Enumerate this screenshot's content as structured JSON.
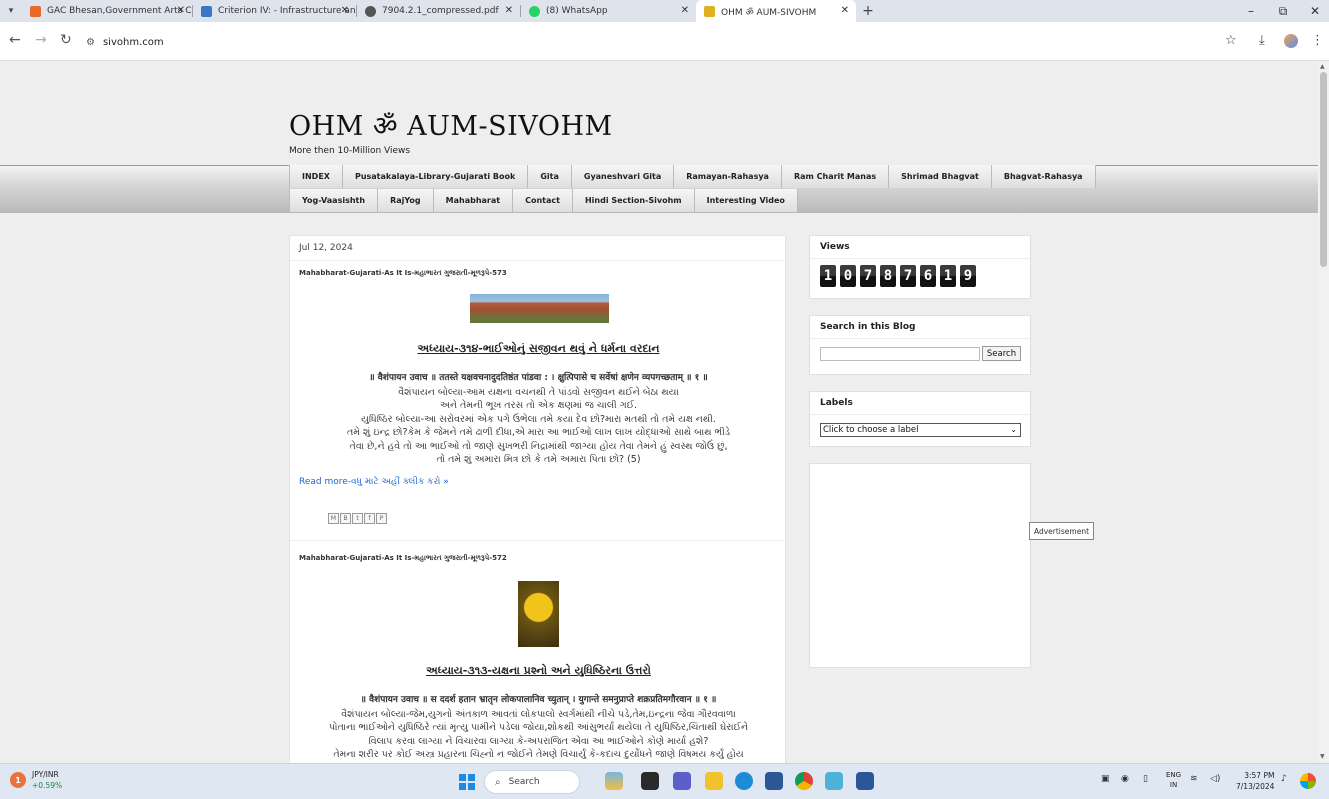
{
  "browser": {
    "tabs": [
      {
        "label": "GAC Bhesan,Government Arts C",
        "icon": "college-favicon-icon",
        "color": "#e66b2a"
      },
      {
        "label": "Criterion IV: - Infrastructure and",
        "icon": "site-favicon-icon",
        "color": "#3b78c4"
      },
      {
        "label": "7904.2.1_compressed.pdf",
        "icon": "globe-favicon-icon",
        "color": "#555555"
      },
      {
        "label": "(8) WhatsApp",
        "icon": "whatsapp-favicon-icon",
        "color": "#25d366"
      },
      {
        "label": "OHM ॐ AUM-SIVOHM",
        "icon": "om-favicon-icon",
        "color": "#e0b020"
      }
    ],
    "url": "sivohm.com"
  },
  "blog": {
    "title": "OHM ॐ AUM-SIVOHM",
    "description": "More then 10-Million Views",
    "nav_row1": [
      "INDEX",
      "Pusatakalaya-Library-Gujarati Book",
      "Gita",
      "Gyaneshvari Gita",
      "Ramayan-Rahasya",
      "Ram Charit Manas",
      "Shrimad Bhagvat",
      "Bhagvat-Rahasya"
    ],
    "nav_row2": [
      "Yog-Vaasishth",
      "RajYog",
      "Mahabharat",
      "Contact",
      "Hindi Section-Sivohm",
      "Interesting Video"
    ]
  },
  "posts": {
    "date": "Jul 12, 2024",
    "post1": {
      "title": "Mahabharat-Gujarati-As It Is-મહાભારત ગુજરાતી-મૂળરૂપે-573",
      "chapter": "અધ્યાય-૩૧૪-ભાઈઓનું સજીવન થવું ને ધર્મના વરદાન",
      "sanskrit": "॥ वैशंपायन उवाच ॥ ततस्ते यक्षवचनादुदतिष्ठंत पांडवा : । क्षुत्पिपासे च सर्वेषां क्षणेन व्यपगच्छताम् ॥ १ ॥",
      "lines": [
        "વૈશંપાયન બોલ્યા-આમ યક્ષના વચનથી તે પાંડવો સજીવન થઈને બેઠા થયા",
        "અને તેમની ભૂખ તરસ તો એક ક્ષણમાં જ ચાલી ગઈ.",
        "યુધિષ્ઠિર બોલ્યા-આ સરોવરમાં એક પગે ઉભેલા તમે કયા દેવ છો?મારા મતથી તો તમે યક્ષ નથી.",
        "તમે શું ઇન્દ્ર છો?કેમ કે જેમને તમે ઢાળી દીધા,એ મારા આ ભાઈઓ લાખ લાખ યોદ્ધાઓ સાથે બાથ ભીડે",
        "તેવા છે,ને હવે તો આ ભાઈઓ તો જાણે સુખભરી નિદ્રામાંથી જાગ્યા હોય તેવા તેમને હું સ્વસ્થ જોઉં છું,",
        "તો તમે શું અમારા મિત્ર છો કે તમે અમારા પિતા છો? (5)"
      ],
      "read_more": "Read more-વધુ માટે અહીં ક્લીક કરો »"
    },
    "post2": {
      "title": "Mahabharat-Gujarati-As It Is-મહાભારત ગુજરાતી-મૂળરૂપે-572",
      "chapter": "અધ્યાય-૩૧૩-યક્ષના પ્રશ્નો અને યુધિષ્ઠિરના ઉત્તરો",
      "sanskrit": "॥ वैशंपायन उवाच ॥ स ददर्श हतान भ्रातृन लोकपालानिव च्युतान् । युगान्ते समनुप्राप्ते शक्रप्रतिमगौरवान ॥ १ ॥",
      "lines": [
        "વૈશંપાયન બોલ્યા-જેમ,યુગનો અંતકાળ આવતાં લોકપાલો સ્વર્ગમાંથી નીચે પડે,તેમ,ઇન્દ્રના જેવા ગૌરવવાળા",
        "પોતાના ભાઈઓને યુધિષ્ઠિરે ત્યાં મૃત્યુ પામીને પડેલા જોયા,શોકથી આંસુભર્યા થયેલા તે યુધિષ્ઠિર,ચિંતાથી ઘેરાઈને",
        "વિલાપ કરવા લાગ્યા ને વિચારવા લાગ્યા કે-અપરાજિત એવા આ ભાઈઓને કોણે માર્યા હશે?",
        "તેમના શરીર પર કોઈ અસ્ત્ર પ્રહારના ચિહ્નો ન જોઈને તેમણે વિચાર્યું કે-કદાચ દુર્યોધને જાણે વિષમય કર્યું હોય"
      ]
    }
  },
  "sidebar": {
    "views_title": "Views",
    "views_digits": [
      "1",
      "0",
      "7",
      "8",
      "7",
      "6",
      "1",
      "9"
    ],
    "search_title": "Search in this Blog",
    "search_button": "Search",
    "labels_title": "Labels",
    "labels_select": "Click to choose a label",
    "ad_tooltip": "Advertisement"
  },
  "taskbar": {
    "ticker_badge": "1",
    "ticker_symbol": "JPY/INR",
    "ticker_change": "+0.59%",
    "search_label": "Search",
    "lang_line1": "ENG",
    "lang_line2": "IN",
    "time": "3:57 PM",
    "date": "7/13/2024"
  }
}
